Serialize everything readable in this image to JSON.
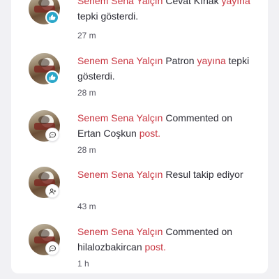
{
  "notifications": [
    {
      "actor": "Senem Sena Yalçın",
      "target": "Cevat Kırlak",
      "link": "yayına",
      "tail": "tepki gösterdi.",
      "time": "27 m",
      "icon": "thumbs-up-icon"
    },
    {
      "actor": "Senem Sena Yalçın",
      "target": "Patron",
      "link": "yayına",
      "tail": "tepki gösterdi.",
      "time": "28 m",
      "icon": "thumbs-up-icon"
    },
    {
      "actor": "Senem Sena Yalçın",
      "verb": "Commented on",
      "target": "Ertan Coşkun",
      "link": "post.",
      "time": "28 m",
      "icon": "comment-icon"
    },
    {
      "actor": "Senem Sena Yalçın",
      "target": "Resul",
      "tail": "takip ediyor",
      "time": "43 m",
      "icon": "add-user-icon"
    },
    {
      "actor": "Senem Sena Yalçın",
      "verb": "Commented on",
      "target": "hilalozbakircan",
      "link": "post.",
      "time": "1 h",
      "icon": "comment-icon"
    }
  ],
  "colors": {
    "accent": "#c8343f",
    "like_badge": "#2ba7c9"
  }
}
